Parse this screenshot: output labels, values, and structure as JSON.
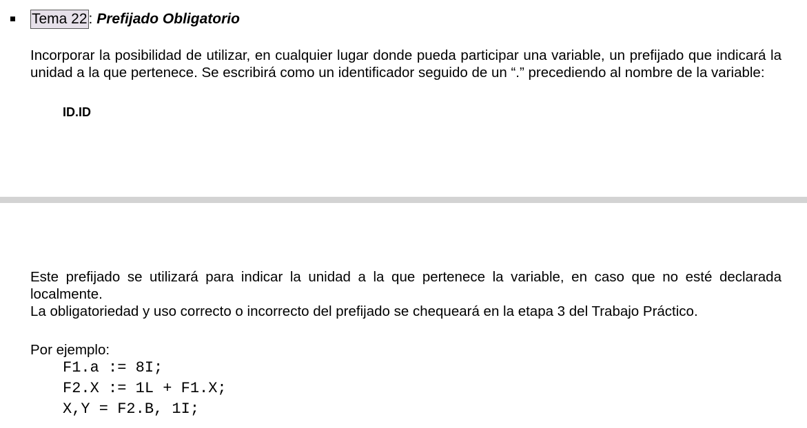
{
  "section": {
    "tema_label": "Tema 22",
    "separator": ":",
    "subject": "Prefijado Obligatorio"
  },
  "intro_paragraph": "Incorporar la posibilidad de utilizar, en cualquier lugar donde pueda participar una variable, un prefijado que indicará la unidad a la que pertenece. Se escribirá como un identificador seguido de un “.” precediendo al nombre de la variable:",
  "syntax": "ID.ID",
  "usage_paragraph": "Este prefijado se utilizará para indicar la unidad a la que pertenece la variable, en caso que no esté declarada localmente.",
  "check_paragraph": "La obligatoriedad y uso correcto o incorrecto del prefijado se chequeará en la etapa 3 del Trabajo Práctico.",
  "example_label": "Por ejemplo:",
  "code_lines": [
    "F1.a := 8I;",
    "F2.X := 1L + F1.X;",
    "X,Y = F2.B, 1I;"
  ],
  "colors": {
    "page_gap": "#d3d3d3",
    "highlight": "#e6e0ea"
  }
}
